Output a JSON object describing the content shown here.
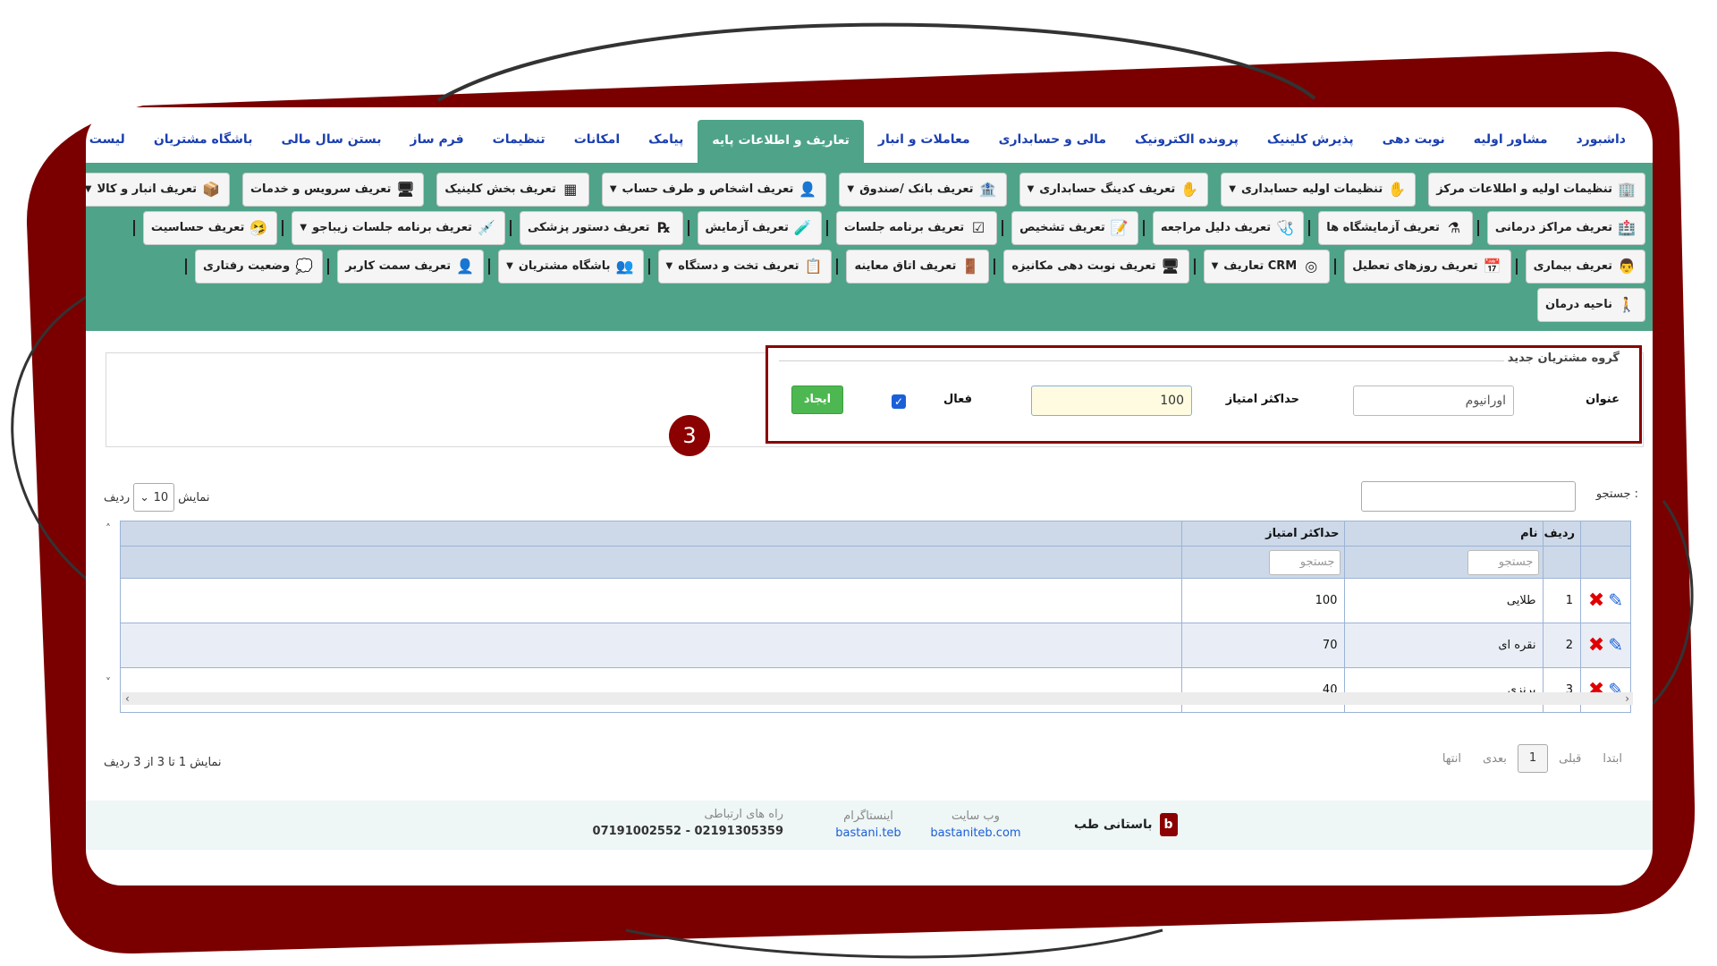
{
  "menu": [
    {
      "label": "داشبورد",
      "active": false
    },
    {
      "label": "مشاور اولیه",
      "active": false
    },
    {
      "label": "نوبت دهی",
      "active": false
    },
    {
      "label": "پذیرش کلینیک",
      "active": false
    },
    {
      "label": "پرونده الکترونیک",
      "active": false
    },
    {
      "label": "مالی و حسابداری",
      "active": false
    },
    {
      "label": "معاملات و انبار",
      "active": false
    },
    {
      "label": "تعاریف و اطلاعات پایه",
      "active": true
    },
    {
      "label": "پیامک",
      "active": false
    },
    {
      "label": "امکانات",
      "active": false
    },
    {
      "label": "تنظیمات",
      "active": false
    },
    {
      "label": "فرم ساز",
      "active": false
    },
    {
      "label": "بستن سال مالی",
      "active": false
    },
    {
      "label": "باشگاه مشتریان",
      "active": false
    },
    {
      "label": "لیست ماژول ها",
      "active": false
    }
  ],
  "toolbar": {
    "row1": [
      {
        "label": "تنظیمات اولیه و اطلاعات مرکز",
        "icon": "building-icon",
        "caret": false
      },
      {
        "label": "تنظیمات اولیه حسابداری",
        "icon": "hand-icon",
        "caret": true
      },
      {
        "label": "تعریف کدینگ حسابداری",
        "icon": "hand-icon",
        "caret": true
      },
      {
        "label": "تعریف بانک /صندوق",
        "icon": "bank-icon",
        "caret": true
      },
      {
        "label": "تعریف اشخاص و طرف حساب",
        "icon": "person-icon",
        "caret": true
      },
      {
        "label": "تعریف بخش کلینیک",
        "icon": "grid-icon",
        "caret": false
      },
      {
        "label": "تعریف سرویس و خدمات",
        "icon": "monitor-icon",
        "caret": false
      },
      {
        "label": "تعریف انبار و کالا",
        "icon": "box-icon",
        "caret": true
      }
    ],
    "row2": [
      {
        "label": "تعریف مراکز درمانی",
        "icon": "hospital-icon",
        "caret": false
      },
      {
        "label": "تعریف آزمایشگاه ها",
        "icon": "lab-icon",
        "caret": false
      },
      {
        "label": "تعریف دلیل مراجعه",
        "icon": "stethoscope-icon",
        "caret": false
      },
      {
        "label": "تعریف تشخیص",
        "icon": "document-icon",
        "caret": false
      },
      {
        "label": "تعریف برنامه جلسات",
        "icon": "checklist-icon",
        "caret": false
      },
      {
        "label": "تعریف آزمایش",
        "icon": "flask-icon",
        "caret": false
      },
      {
        "label": "تعریف دستور پزشکی",
        "icon": "prescription-icon",
        "caret": false
      },
      {
        "label": "تعریف برنامه جلسات زیباجو",
        "icon": "cosmetic-icon",
        "caret": true
      },
      {
        "label": "تعریف حساسیت",
        "icon": "allergy-icon",
        "caret": false
      }
    ],
    "row3": [
      {
        "label": "تعریف بیماری",
        "icon": "doctor-icon",
        "caret": false
      },
      {
        "label": "تعریف روزهای تعطیل",
        "icon": "calendar-icon",
        "caret": false
      },
      {
        "label": "تعاریف CRM",
        "icon": "crm-icon",
        "caret": true
      },
      {
        "label": "تعریف نوبت دهی مکانیزه",
        "icon": "monitor-icon",
        "caret": false
      },
      {
        "label": "تعریف اتاق معاینه",
        "icon": "room-icon",
        "caret": false
      },
      {
        "label": "تعریف تخت و دستگاه",
        "icon": "clipboard-icon",
        "caret": true
      },
      {
        "label": "باشگاه مشتریان",
        "icon": "group-icon",
        "caret": true
      },
      {
        "label": "تعریف سمت کاربر",
        "icon": "user-icon",
        "caret": false
      },
      {
        "label": "وضعیت رفتاری",
        "icon": "behavior-icon",
        "caret": false
      }
    ],
    "row4": [
      {
        "label": "ناحیه درمان",
        "icon": "body-icon",
        "caret": false
      }
    ]
  },
  "form": {
    "legend": "گروه مشتریان جدید",
    "title_label": "عنوان",
    "title_value": "اورانیوم",
    "max_label": "حداکثر امتیاز",
    "max_value": "100",
    "active_label": "فعال",
    "active_checked": true,
    "create_label": "ایجاد",
    "step_number": "3"
  },
  "table_controls": {
    "search_label": "جستجو :",
    "show_label": "نمایش",
    "rows_value": "10",
    "rows_label": "ردیف"
  },
  "table": {
    "headers": {
      "row": "ردیف",
      "name": "نام",
      "max": "حداکثر امتیاز"
    },
    "search_placeholder": "جستجو",
    "rows": [
      {
        "row": "1",
        "name": "طلایی",
        "max": "100"
      },
      {
        "row": "2",
        "name": "نقره ای",
        "max": "70"
      },
      {
        "row": "3",
        "name": "برنزی",
        "max": "40"
      }
    ]
  },
  "pagination": {
    "info": "نمایش 1 تا 3 از 3 ردیف",
    "first": "ابتدا",
    "prev": "قبلی",
    "current": "1",
    "next": "بعدی",
    "last": "انتها"
  },
  "footer": {
    "brand": "باستانی طب",
    "website_title": "وب سایت",
    "website_value": "bastaniteb.com",
    "instagram_title": "اینستاگرام",
    "instagram_value": "bastani.teb",
    "contact_title": "راه های ارتباطی",
    "contact_value": "07191002552 - 02191305359"
  },
  "colors": {
    "accent_green": "#4ea389",
    "frame_red": "#8b0000",
    "link_blue": "#1a3fb0"
  }
}
